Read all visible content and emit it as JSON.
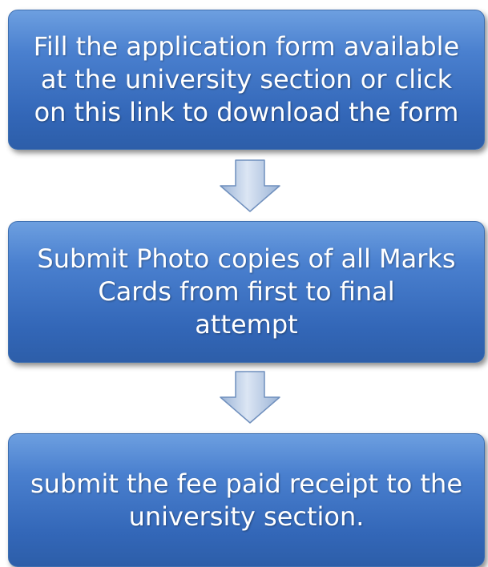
{
  "steps": [
    {
      "text": "Fill the application form available\nat the university section or click\non this link to download the form"
    },
    {
      "text": "Submit Photo copies of all Marks\nCards  from first  to  final\nattempt"
    },
    {
      "text": "submit the fee paid receipt to the\nuniversity section."
    }
  ],
  "colors": {
    "box_top": "#6d9fe0",
    "box_bottom": "#2d5ea9",
    "box_text": "#ffffff",
    "arrow_fill_light": "#dce6f4",
    "arrow_fill_dark": "#9ab3d6",
    "arrow_stroke": "#6f8fbd"
  }
}
